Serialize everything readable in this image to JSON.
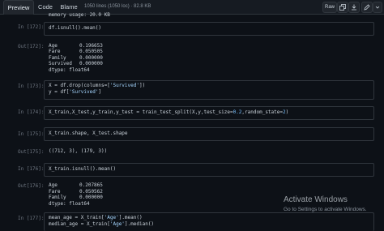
{
  "tabs": {
    "preview": "Preview",
    "code": "Code",
    "blame": "Blame"
  },
  "file_info": "1050 lines (1050 loc) · 82.8 KB",
  "toolbar": {
    "raw": "Raw",
    "copy_icon": "copy-icon",
    "download_icon": "download-icon",
    "edit_icon": "pencil-icon",
    "more_icon": "chevron-down-icon"
  },
  "memory_line": "memory usage: 20.0 KB",
  "cells": {
    "c172_in_prompt": "In [172]:",
    "c172_code": "df.isnull().mean()",
    "c172_out_prompt": "Out[172]:",
    "c172_out": [
      {
        "name": "Age",
        "value": "0.196653"
      },
      {
        "name": "Fare",
        "value": "0.050505"
      },
      {
        "name": "Family",
        "value": "0.000000"
      },
      {
        "name": "Survived",
        "value": "0.000000"
      }
    ],
    "c172_dtype": "dtype: float64",
    "c173_in_prompt": "In [173]:",
    "c173_line1_a": "X = df.drop(columns=[",
    "c173_line1_str": "'Survived'",
    "c173_line1_b": "])",
    "c173_line2_a": "y = df[",
    "c173_line2_str": "'Survived'",
    "c173_line2_b": "]",
    "c174_in_prompt": "In [174]:",
    "c174_a": "X_train,X_test,y_train,y_test = train_test_split(X,y,test_size=",
    "c174_n1": "0.2",
    "c174_b": ",random_state=",
    "c174_n2": "2",
    "c174_c": ")",
    "c175_in_prompt": "In [175]:",
    "c175_code": "X_train.shape, X_test.shape",
    "c175_out_prompt": "Out[175]:",
    "c175_out": "((712, 3), (179, 3))",
    "c176_in_prompt": "In [176]:",
    "c176_code": "X_train.isnull().mean()",
    "c176_out_prompt": "Out[176]:",
    "c176_out": [
      {
        "name": "Age",
        "value": "0.207865"
      },
      {
        "name": "Fare",
        "value": "0.050562"
      },
      {
        "name": "Family",
        "value": "0.000000"
      }
    ],
    "c176_dtype": "dtype: float64",
    "c177_in_prompt": "In [177]:",
    "c177_line1_a": "mean_age = X_train[",
    "c177_line1_str": "'Age'",
    "c177_line1_b": "].mean()",
    "c177_line2_a": "median_age = X_train[",
    "c177_line2_str": "'Age'",
    "c177_line2_b": "].median()"
  },
  "watermark": {
    "title": "Activate Windows",
    "subtitle": "Go to Settings to activate Windows."
  }
}
